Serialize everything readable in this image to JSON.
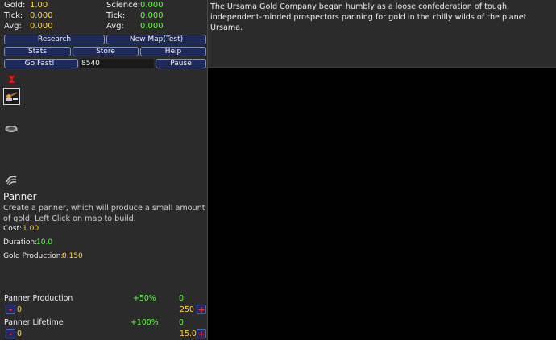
{
  "stats": {
    "gold_label": "Gold:",
    "gold_value": "1.00",
    "tick_label": "Tick:",
    "tick_value": "0.000",
    "avg_label": "Avg:",
    "avg_value": "0.000",
    "science_label": "Science:",
    "science_value": "0.000",
    "sci_tick_label": "Tick:",
    "sci_tick_value": "0.000",
    "sci_avg_label": "Avg:",
    "sci_avg_value": "0.000"
  },
  "buttons": {
    "research": "Research",
    "new_map": "New Map(Test)",
    "stats": "Stats",
    "store": "Store",
    "help": "Help",
    "go_fast": "Go Fast!!",
    "speed_value": "8540",
    "pause": "Pause"
  },
  "tools": [
    "close-marker-icon",
    "pickaxe-panner-icon",
    "pan-icon",
    "sluice-icon"
  ],
  "selected": {
    "name": "Panner",
    "description": "Create a panner, which will produce a small amount of gold. Left Click on map to build.",
    "cost_label": "Cost:",
    "cost_value": "1.00",
    "duration_label": "Duration:",
    "duration_value": "10.0",
    "gold_prod_label": "Gold Production:",
    "gold_prod_value": "0.150"
  },
  "upgrades": [
    {
      "name": "Panner Production",
      "bonus": "+50%",
      "level": "0",
      "left_value": "0",
      "cost": "250"
    },
    {
      "name": "Panner Lifetime",
      "bonus": "+100%",
      "level": "0",
      "left_value": "0",
      "cost": "15.0"
    }
  ],
  "upgrade_controls": {
    "minus": "-",
    "plus": "+"
  },
  "story": "The Ursama Gold Company began humbly as a loose confederation of tough, independent-minded prospectors panning for gold in the chilly wilds of the planet Ursama."
}
